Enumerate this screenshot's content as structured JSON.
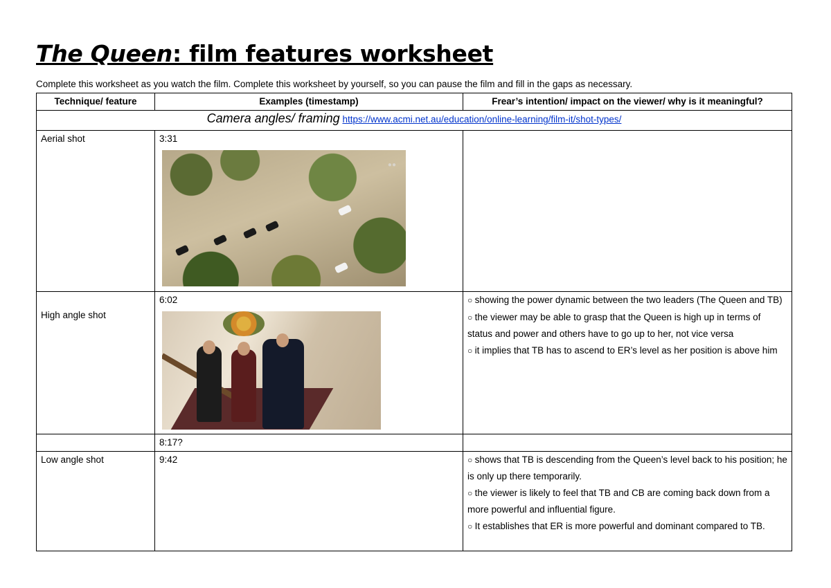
{
  "document": {
    "title_italic": "The Queen",
    "title_rest": ": film features worksheet",
    "intro": "Complete this worksheet as you watch the film. Complete this worksheet by yourself, so you can pause the film and fill in the gaps as necessary."
  },
  "table": {
    "headers": [
      "Technique/ feature",
      "Examples (timestamp)",
      "Frear’s intention/ impact on the viewer/ why is it meaningful?"
    ],
    "section": {
      "title": "Camera angles/ framing",
      "link": "https://www.acmi.net.au/education/online-learning/film-it/shot-types/"
    },
    "rows": [
      {
        "technique": "Aerial shot",
        "timestamp": "3:31",
        "image": "aerial-city-street-image",
        "notes": []
      },
      {
        "technique": "High angle shot",
        "timestamp": "6:02",
        "image": "staircase-scene-image",
        "notes": [
          "showing the power dynamic between the two leaders (The Queen and TB)",
          "the viewer may be able to grasp that the Queen is high up in terms of status and power and others have to go up to her, not vice versa",
          "it implies that TB has to ascend to ER’s level as her position is above him"
        ]
      },
      {
        "technique": "",
        "timestamp": "8:17?",
        "notes": []
      },
      {
        "technique": "Low angle shot",
        "timestamp": "9:42",
        "notes": [
          "shows that TB is descending from the Queen’s level back to his position; he is only up there temporarily.",
          "the viewer is likely to feel that TB and CB are coming back down from a more powerful and influential figure.",
          "It establishes that ER is more powerful and dominant compared to TB."
        ]
      }
    ]
  },
  "colors": {
    "link": "#0033cc",
    "text": "#000000",
    "background": "#ffffff"
  }
}
